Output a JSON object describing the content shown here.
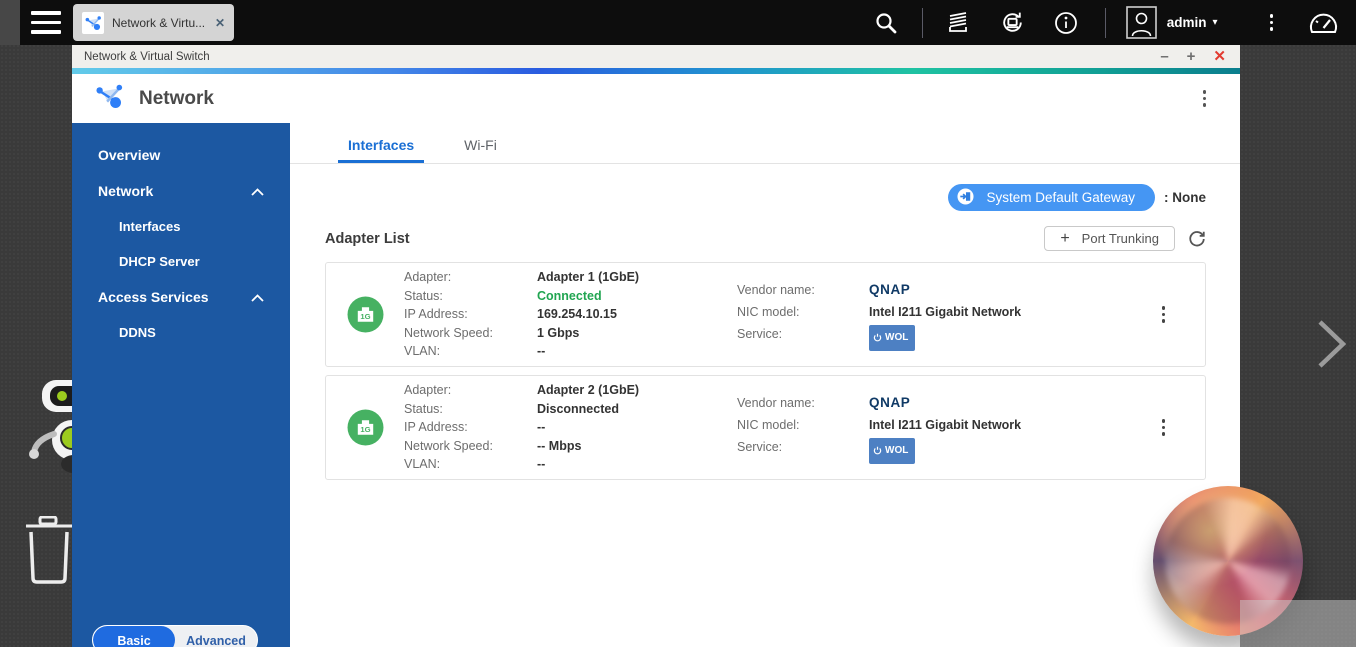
{
  "glyphs": {
    "close_tab": "✕",
    "minimize": "–",
    "maximize": "+",
    "close_window": "✕",
    "caret_down": "▾",
    "plus": "+",
    "truncation": "..."
  },
  "colors": {
    "sidebar_blue": "#1c58a2",
    "accent_blue": "#1a6fd4",
    "gateway_button": "#4596f3",
    "status_green": "#21a551",
    "wol_badge": "#4d80c3",
    "qnap_navy": "#103a66",
    "close_red": "#e23b30"
  },
  "topbar": {
    "tab_label": "Network & Virtu...",
    "user_label": "admin"
  },
  "window": {
    "title": "Network & Virtual Switch",
    "app_title": "Network"
  },
  "sidebar": {
    "items": [
      {
        "label": "Overview"
      },
      {
        "label": "Network"
      },
      {
        "label": "Interfaces"
      },
      {
        "label": "DHCP Server"
      },
      {
        "label": "Access Services"
      },
      {
        "label": "DDNS"
      }
    ],
    "toggle": {
      "basic": "Basic",
      "advanced": "Advanced"
    }
  },
  "tabs": [
    {
      "label": "Interfaces"
    },
    {
      "label": "Wi-Fi"
    }
  ],
  "gateway": {
    "button_label": "System Default Gateway",
    "value": ": None"
  },
  "adapter_section": {
    "title": "Adapter List",
    "port_trunking": "Port Trunking"
  },
  "adapters": [
    {
      "icon_label": "1G",
      "status_class": "green",
      "rows": [
        {
          "label": "Adapter:",
          "value": "Adapter 1 (1GbE)"
        },
        {
          "label": "Status:",
          "value": "Connected"
        },
        {
          "label": "IP Address:",
          "value": "169.254.10.15"
        },
        {
          "label": "Network Speed:",
          "value": "1 Gbps"
        },
        {
          "label": "VLAN:",
          "value": "--"
        }
      ],
      "vendor": {
        "label": "Vendor name:",
        "value": "QNAP"
      },
      "nic": {
        "label": "NIC model:",
        "value": "Intel I211 Gigabit Network"
      },
      "service": {
        "label": "Service:",
        "badge": "WOL"
      }
    },
    {
      "icon_label": "1G",
      "status_class": "plain",
      "rows": [
        {
          "label": "Adapter:",
          "value": "Adapter 2 (1GbE)"
        },
        {
          "label": "Status:",
          "value": "Disconnected"
        },
        {
          "label": "IP Address:",
          "value": "--"
        },
        {
          "label": "Network Speed:",
          "value": "-- Mbps"
        },
        {
          "label": "VLAN:",
          "value": "--"
        }
      ],
      "vendor": {
        "label": "Vendor name:",
        "value": "QNAP"
      },
      "nic": {
        "label": "NIC model:",
        "value": "Intel I211 Gigabit Network"
      },
      "service": {
        "label": "Service:",
        "badge": "WOL"
      }
    }
  ]
}
